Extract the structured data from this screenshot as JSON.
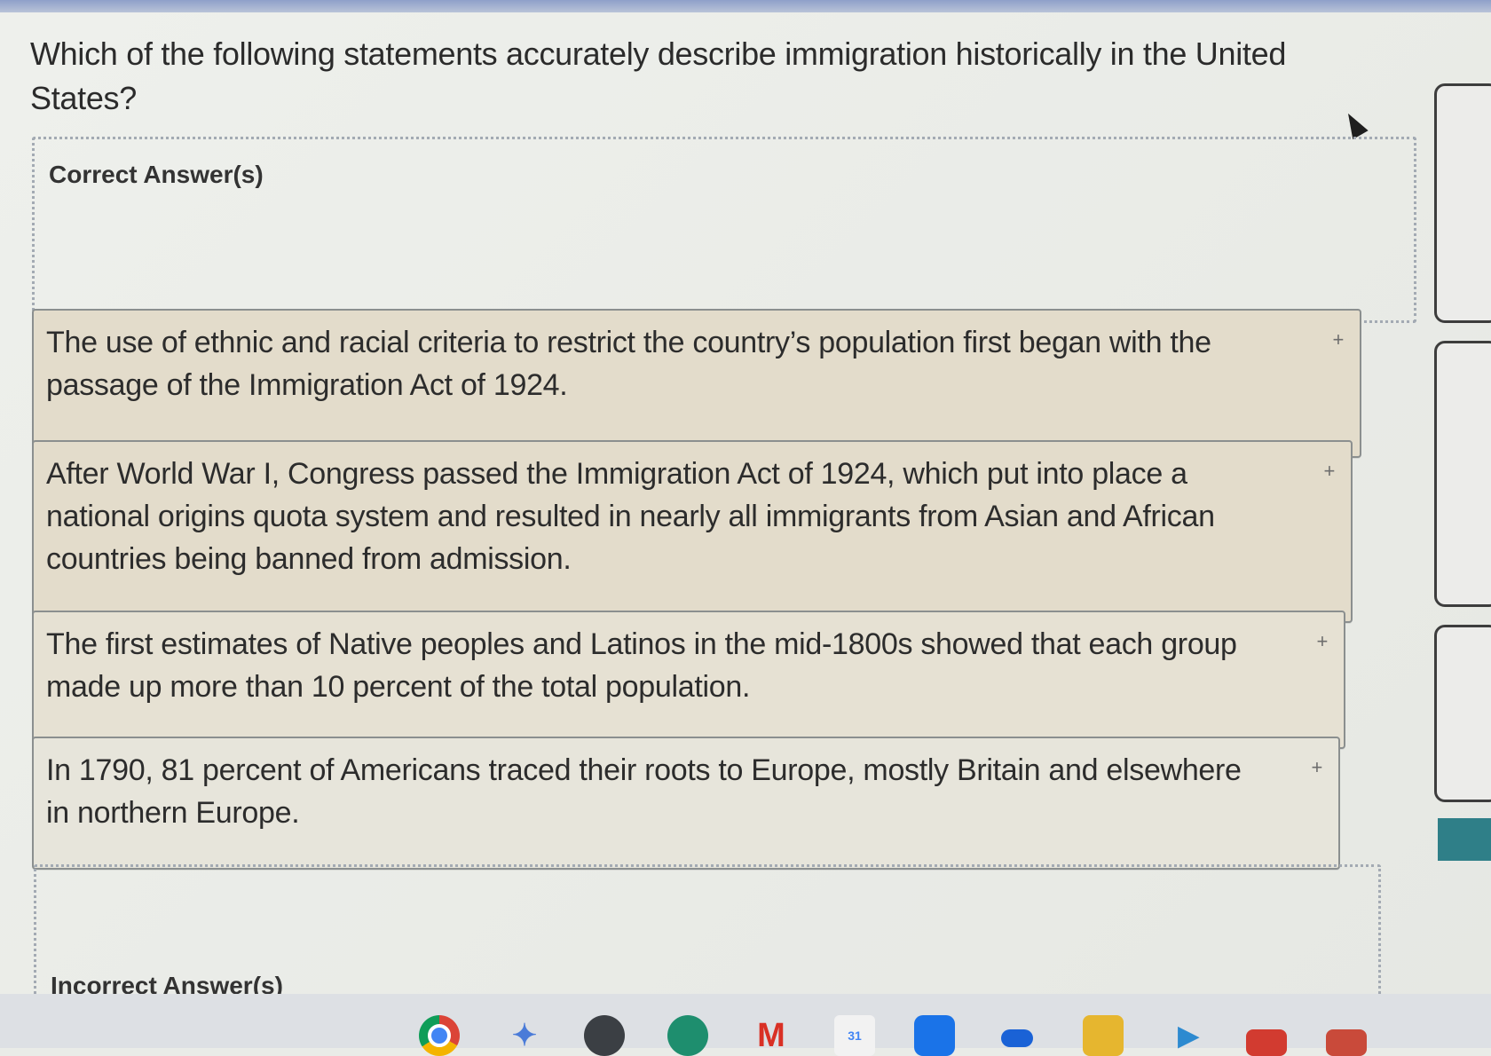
{
  "question": {
    "text": "Which of the following statements accurately describe immigration historically in the United States?"
  },
  "correct_zone": {
    "label": "Correct Answer(s)"
  },
  "incorrect_zone": {
    "label": "Incorrect Answer(s)"
  },
  "answers": [
    {
      "text": "The use of ethnic and racial criteria to restrict the country’s population first began with the passage of the Immigration Act of 1924.",
      "handle": "+"
    },
    {
      "text": "After World War I, Congress passed the Immigration Act of 1924, which put into place a national origins quota system and resulted in nearly all immigrants from Asian and African countries being banned from admission.",
      "handle": "+"
    },
    {
      "text": "The first estimates of Native peoples and Latinos in the mid-1800s showed that each group made up more than 10 percent of the total population.",
      "handle": "+"
    },
    {
      "text": "In 1790, 81 percent of Americans traced their roots to Europe, mostly Britain and elsewhere in northern Europe.",
      "handle": "+"
    }
  ],
  "taskbar": {
    "icons": [
      "chrome-icon",
      "gemini-icon",
      "arc-icon",
      "apps-icon",
      "gmail-icon",
      "calendar-icon",
      "files-icon",
      "dot-icon",
      "yellow-app-icon",
      "play-icon",
      "red-app-icon",
      "sheet-icon"
    ],
    "gemini_glyph": "✦",
    "gmail_glyph": "M",
    "calendar_glyph": "31",
    "play_glyph": "▶"
  },
  "colors": {
    "answer_bg": "#e3dccb",
    "teal_button": "#2f7f88"
  }
}
